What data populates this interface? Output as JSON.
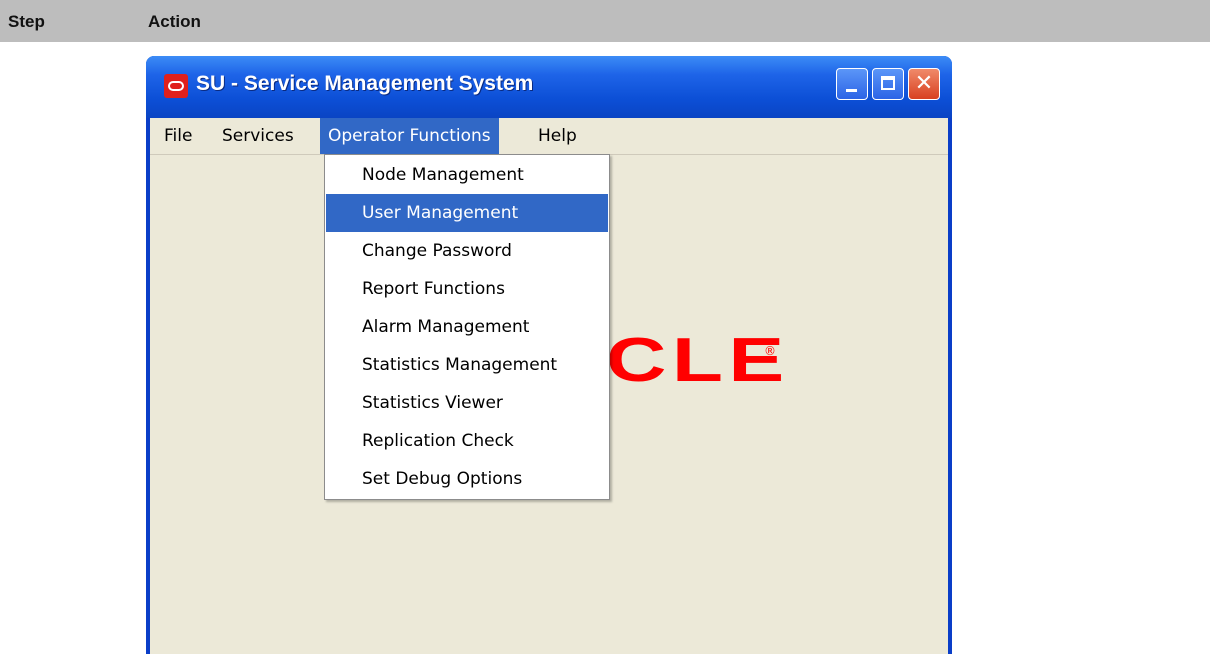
{
  "doc_table": {
    "headers": [
      "Step",
      "Action"
    ]
  },
  "window": {
    "title": "SU - Service Management System",
    "controls": {
      "minimize_icon": "minimize-icon",
      "maximize_icon": "maximize-icon",
      "close_icon": "close-icon",
      "close_glyph": "✕"
    }
  },
  "menubar": {
    "items": [
      "File",
      "Services",
      "Operator Functions",
      "Help"
    ],
    "active": "Operator Functions"
  },
  "dropdown": {
    "items": [
      "Node Management",
      "User Management",
      "Change Password",
      "Report Functions",
      "Alarm Management",
      "Statistics Management",
      "Statistics Viewer",
      "Replication Check",
      "Set Debug Options"
    ],
    "selected": "User Management"
  },
  "background_logo": {
    "visible_text": "CLE",
    "registered_mark": "®"
  },
  "colors": {
    "selection": "#3168c6",
    "logo_red": "#ff0000",
    "titlebar_blue": "#0c4fd6",
    "client_bg": "#ece9d8",
    "doc_header_bg": "#bdbdbd"
  }
}
